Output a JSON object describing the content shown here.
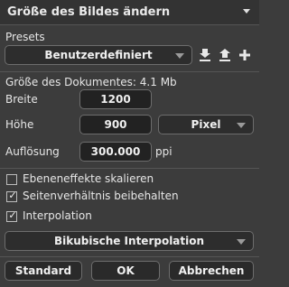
{
  "panel": {
    "title": "Größe des Bildes ändern",
    "collapse_icon": "chevron-down-icon"
  },
  "presets": {
    "label": "Presets",
    "selected": "Benutzerdefiniert",
    "icons": [
      "download-icon",
      "upload-icon",
      "plus-icon"
    ]
  },
  "document_size": {
    "label": "Größe des Dokumentes:",
    "value": "4.1 Mb"
  },
  "width": {
    "label": "Breite",
    "value": "1200"
  },
  "height": {
    "label": "Höhe",
    "value": "900",
    "unit": "Pixel"
  },
  "resolution": {
    "label": "Auflösung",
    "value": "300.000",
    "unit": "ppi"
  },
  "options": [
    {
      "label": "Ebeneneffekte skalieren",
      "checked": false
    },
    {
      "label": "Seitenverhältnis beibehalten",
      "checked": true
    },
    {
      "label": "Interpolation",
      "checked": true
    }
  ],
  "interpolation": {
    "selected": "Bikubische Interpolation"
  },
  "buttons": {
    "standard": "Standard",
    "ok": "OK",
    "cancel": "Abbrechen"
  },
  "colors": {
    "panel_bg": "#3c3c3c",
    "field_bg": "#222222",
    "border": "#6d6d6d",
    "text": "#e6e6e6"
  }
}
